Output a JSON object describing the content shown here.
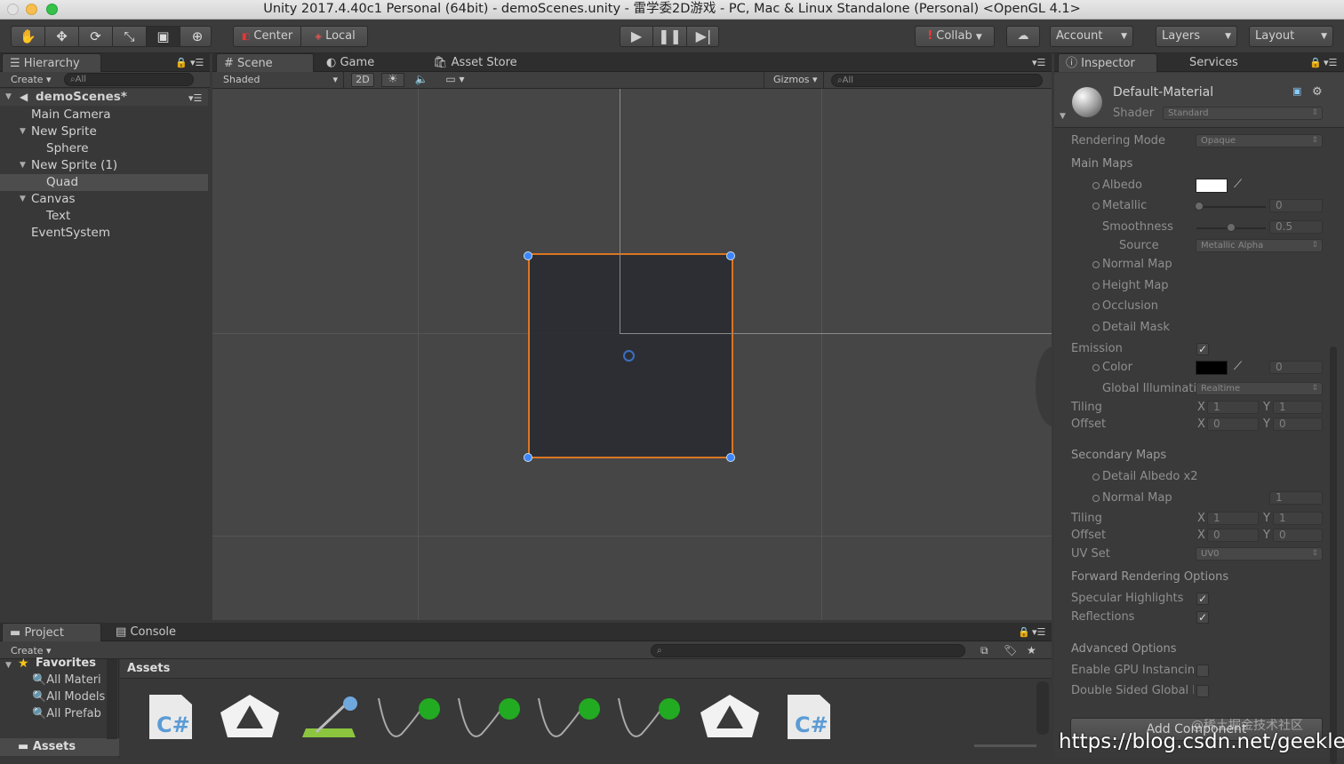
{
  "titlebar": {
    "title": "Unity 2017.4.40c1 Personal (64bit) - demoScenes.unity - 雷学委2D游戏 - PC, Mac & Linux Standalone (Personal) <OpenGL 4.1>"
  },
  "toolbar": {
    "transform_tools": [
      "hand",
      "move",
      "rotate",
      "scale",
      "rect",
      "transform"
    ],
    "pivot_label": "Center",
    "space_label": "Local",
    "collab_label": "Collab",
    "account_label": "Account",
    "layers_label": "Layers",
    "layout_label": "Layout"
  },
  "hierarchy": {
    "tab_label": "Hierarchy",
    "create_label": "Create",
    "search_placeholder": "All",
    "scene_name": "demoScenes*",
    "items": [
      {
        "label": "Main Camera",
        "level": 1,
        "expanded": false,
        "selected": false
      },
      {
        "label": "New Sprite",
        "level": 1,
        "expanded": true,
        "selected": false
      },
      {
        "label": "Sphere",
        "level": 2,
        "expanded": false,
        "selected": false
      },
      {
        "label": "New Sprite (1)",
        "level": 1,
        "expanded": true,
        "selected": false
      },
      {
        "label": "Quad",
        "level": 2,
        "expanded": false,
        "selected": true
      },
      {
        "label": "Canvas",
        "level": 1,
        "expanded": true,
        "selected": false
      },
      {
        "label": "Text",
        "level": 2,
        "expanded": false,
        "selected": false
      },
      {
        "label": "EventSystem",
        "level": 1,
        "expanded": false,
        "selected": false
      }
    ]
  },
  "scene": {
    "tabs": [
      {
        "label": "Scene"
      },
      {
        "label": "Game"
      },
      {
        "label": "Asset Store"
      }
    ],
    "shading_mode": "Shaded",
    "mode_2d_label": "2D",
    "gizmos_label": "Gizmos",
    "search_placeholder": "All"
  },
  "inspector": {
    "tabs": [
      {
        "label": "Inspector"
      },
      {
        "label": "Services"
      }
    ],
    "material_name": "Default-Material",
    "shader_label": "Shader",
    "shader_value": "Standard",
    "rendering_mode_label": "Rendering Mode",
    "rendering_mode_value": "Opaque",
    "main_maps_header": "Main Maps",
    "albedo_label": "Albedo",
    "metallic_label": "Metallic",
    "metallic_value": "0",
    "smoothness_label": "Smoothness",
    "smoothness_value": "0.5",
    "source_label": "Source",
    "source_value": "Metallic Alpha",
    "normal_map_label": "Normal Map",
    "height_map_label": "Height Map",
    "occlusion_label": "Occlusion",
    "detail_mask_label": "Detail Mask",
    "emission_label": "Emission",
    "color_label": "Color",
    "color_value": "0",
    "gi_label": "Global Illuminati",
    "gi_value": "Realtime",
    "tiling_label": "Tiling",
    "offset_label": "Offset",
    "x_label": "X",
    "y_label": "Y",
    "main_tiling_x": "1",
    "main_tiling_y": "1",
    "main_offset_x": "0",
    "main_offset_y": "0",
    "secondary_maps_header": "Secondary Maps",
    "detail_albedo_label": "Detail Albedo x2",
    "sec_normal_map_label": "Normal Map",
    "sec_normal_value": "1",
    "sec_tiling_x": "1",
    "sec_tiling_y": "1",
    "sec_offset_x": "0",
    "sec_offset_y": "0",
    "uv_set_label": "UV Set",
    "uv_set_value": "UV0",
    "forward_header": "Forward Rendering Options",
    "specular_label": "Specular Highlights",
    "reflections_label": "Reflections",
    "advanced_header": "Advanced Options",
    "gpu_instancing_label": "Enable GPU Instancing",
    "double_sided_label": "Double Sided Global Il",
    "add_component_label": "Add Component"
  },
  "project": {
    "tabs": [
      {
        "label": "Project"
      },
      {
        "label": "Console"
      }
    ],
    "create_label": "Create",
    "favorites_label": "Favorites",
    "favorites": [
      "All Materi",
      "All Models",
      "All Prefab"
    ],
    "assets_root_label": "Assets",
    "breadcrumb": "Assets"
  },
  "watermark": {
    "text": "https://blog.csdn.net/geeklevin",
    "cn_text": "@稀土掘金技术社区"
  },
  "colors": {
    "selection_orange": "#e87b1f",
    "handle_blue": "#3a86ff",
    "script_green": "#22aa22"
  }
}
